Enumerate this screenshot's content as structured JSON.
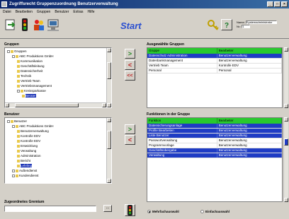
{
  "window": {
    "title": "Zugriffsrecht Gruppenzuordnung Benutzerverwaltung",
    "minimize": "_",
    "maximize": "□",
    "close": "×"
  },
  "menu": [
    "Datei",
    "Bearbeiten",
    "Gruppen",
    "Benutzer",
    "Extras",
    "Hilfe"
  ],
  "toolbar": {
    "start_label": "Start",
    "tools": [
      "exit-icon",
      "traffic-light-icon",
      "users-icon",
      "computer-icon"
    ],
    "help_tools": [
      "key-icon",
      "help-icon"
    ],
    "info": {
      "line1_label": "Name:",
      "line1_value": "Systemadministrator",
      "line2_label": "Nr.:",
      "line2_value": "1"
    }
  },
  "groups_tree": {
    "label": "Gruppen",
    "nodes": [
      {
        "text": "Gruppen",
        "depth": 0,
        "expander": true,
        "selected": false
      },
      {
        "text": "ABC Produktions GmbH",
        "depth": 1,
        "expander": true,
        "selected": false
      },
      {
        "text": "Kommunikation",
        "depth": 2,
        "expander": false,
        "selected": false
      },
      {
        "text": "Geschäftsleitung",
        "depth": 2,
        "expander": false,
        "selected": false
      },
      {
        "text": "Datensicherheit",
        "depth": 2,
        "expander": false,
        "selected": false
      },
      {
        "text": "Technik",
        "depth": 2,
        "expander": false,
        "selected": false
      },
      {
        "text": "Vertrieb Team",
        "depth": 2,
        "expander": false,
        "selected": false
      },
      {
        "text": "Vertriebsmanagement",
        "depth": 2,
        "expander": false,
        "selected": false
      },
      {
        "text": "Kreissparkasse",
        "depth": 2,
        "expander": true,
        "selected": false
      },
      {
        "text": "Berater",
        "depth": 3,
        "expander": false,
        "selected": true
      }
    ]
  },
  "users_tree": {
    "label": "Benutzer",
    "nodes": [
      {
        "text": "Benutzer",
        "depth": 0,
        "expander": true,
        "selected": false
      },
      {
        "text": "ABC Produktions GmbH",
        "depth": 1,
        "expander": true,
        "selected": false
      },
      {
        "text": "Benutzerverwaltung",
        "depth": 2,
        "expander": false,
        "selected": false
      },
      {
        "text": "Kontrolle EDV",
        "depth": 2,
        "expander": false,
        "selected": false
      },
      {
        "text": "Kontrolle EDV",
        "depth": 2,
        "expander": false,
        "selected": false
      },
      {
        "text": "Entwicklung",
        "depth": 2,
        "expander": false,
        "selected": false
      },
      {
        "text": "Verwaltung",
        "depth": 2,
        "expander": false,
        "selected": false
      },
      {
        "text": "Administration",
        "depth": 2,
        "expander": false,
        "selected": false
      },
      {
        "text": "Bericht",
        "depth": 2,
        "expander": false,
        "selected": false
      },
      {
        "text": "Lehrling",
        "depth": 2,
        "expander": false,
        "selected": true
      },
      {
        "text": "Außendienst",
        "depth": 1,
        "expander": true,
        "selected": false
      },
      {
        "text": "Kundendienst",
        "depth": 1,
        "expander": true,
        "selected": false
      }
    ]
  },
  "selected_groups": {
    "label": "Ausgewählte Gruppen",
    "columns": [
      "Gruppe",
      "Bearbeiter"
    ],
    "rows": [
      {
        "cells": [
          "Datenschutz Administration",
          "Benutzerverwaltung"
        ],
        "selected": true
      },
      {
        "cells": [
          "Datenbankmanagement",
          "Benutzerverwaltung"
        ],
        "selected": false
      },
      {
        "cells": [
          "Vertrieb Team",
          "Kontrolle EDV"
        ],
        "selected": false
      },
      {
        "cells": [
          "Personal",
          "Personal"
        ],
        "selected": false
      }
    ]
  },
  "group_functions": {
    "label": "Funktionen in der Gruppe",
    "columns": [
      "Funktion",
      "Bearbeiter"
    ],
    "rows": [
      {
        "cells": [
          "Datensicherungsanlage",
          "Benutzerverwaltung"
        ],
        "selected": true
      },
      {
        "cells": [
          "Profile Bearbeiten",
          "Benutzerverwaltung"
        ],
        "selected": true
      },
      {
        "cells": [
          "Liste Benutzer",
          "Benutzerverwaltung"
        ],
        "selected": true
      },
      {
        "cells": [
          "Passwortverwaltung",
          "Benutzerverwaltung"
        ],
        "selected": false
      },
      {
        "cells": [
          "Programmvorlage",
          "Benutzerverwaltung"
        ],
        "selected": false
      },
      {
        "cells": [
          "Geschäftsübergabe",
          "Benutzerverwaltung"
        ],
        "selected": true
      },
      {
        "cells": [
          "Verwaltung",
          "Benutzerverwaltung"
        ],
        "selected": true
      }
    ]
  },
  "responsible": {
    "label": "Zugeordnetes Gremium",
    "value": "",
    "browse": "..."
  },
  "selection_mode": {
    "options": [
      "Mehrfachauswahl",
      "Einfachauswahl"
    ],
    "selected_index": 0
  },
  "colors": {
    "grid_header": "#29c92e",
    "selection": "#1f3cc4",
    "accent": "#2a4fd0"
  }
}
